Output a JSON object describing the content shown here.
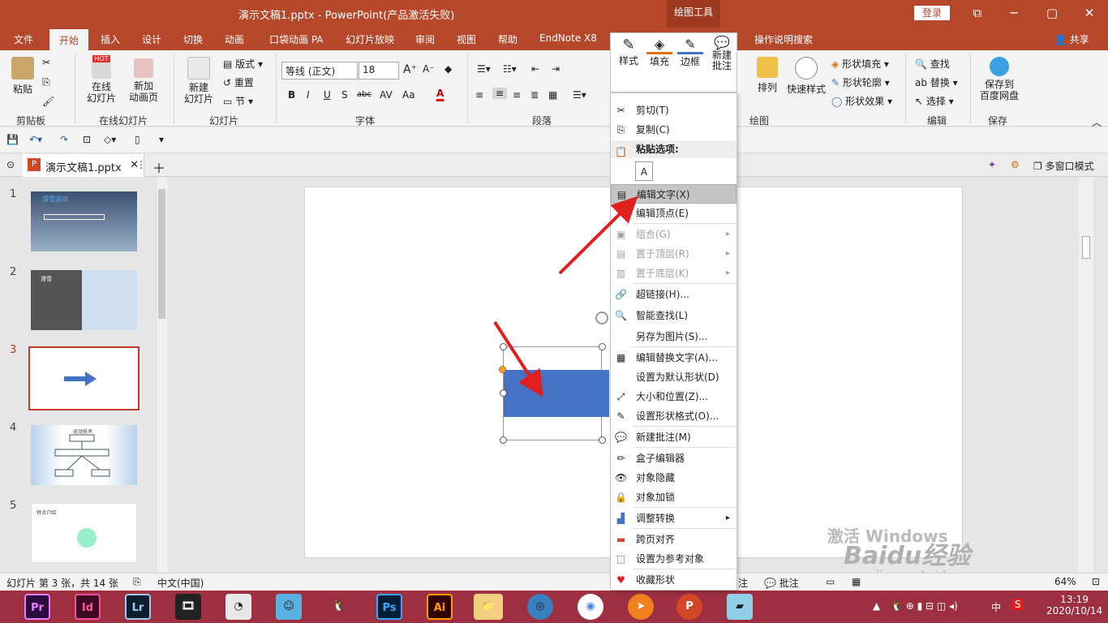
{
  "titlebar": {
    "title": "演示文稿1.pptx  -  PowerPoint(产品激活失败)",
    "context_tab": "绘图工具",
    "login": "登录",
    "restore_icon": "⧉",
    "min": "─",
    "max": "▢",
    "close": "✕"
  },
  "tabs": [
    "文件",
    "开始",
    "插入",
    "设计",
    "切换",
    "动画",
    "口袋动画 PA",
    "幻灯片放映",
    "审阅",
    "视图",
    "帮助",
    "EndNote X8"
  ],
  "tell_me": "操作说明搜索",
  "share": "共享",
  "ribbon": {
    "paste": "粘贴",
    "clipboard": "剪贴板",
    "online_slide": "在线\n幻灯片",
    "new_anim": "新加\n动画页",
    "online_group": "在线幻灯片",
    "hot": "HOT",
    "new_slide": "新建\n幻灯片",
    "layout": "版式",
    "reset": "重置",
    "section": "节",
    "slides_group": "幻灯片",
    "font_name": "等线 (正文)",
    "font_size": "18",
    "font_group": "字体",
    "bold": "B",
    "italic": "I",
    "underline": "U",
    "shadow": "S",
    "strike": "abc",
    "spacing": "AV",
    "case": "Aa",
    "color": "A",
    "para_group": "段落",
    "arrange": "排列",
    "quick_style": "快速样式",
    "drawing_group": "绘图",
    "shape_fill": "形状填充",
    "shape_outline": "形状轮廓",
    "shape_effect": "形状效果",
    "find": "查找",
    "replace": "替换",
    "select": "选择",
    "edit_group": "编辑",
    "save_baidu": "保存到\n百度网盘",
    "save_group": "保存"
  },
  "doc_tab": {
    "name": "演示文稿1.pptx",
    "multi_window": "多窗口模式"
  },
  "thumbs": [
    "1",
    "2",
    "3",
    "4",
    "5"
  ],
  "thumb_texts": {
    "t1": "滑雪运动",
    "t2": "滑雪",
    "t4": "运动技术",
    "t5": "特点介绍"
  },
  "status": {
    "slide": "幻灯片 第 3 张，共 14 张",
    "lang": "中文(中国)",
    "notes": "注",
    "comments": "批注",
    "zoom": "64%"
  },
  "mini_toolbar": [
    "样式",
    "填充",
    "边框",
    "新建\n批注"
  ],
  "menu": {
    "items": [
      {
        "label": "剪切(T)",
        "icon": "✂",
        "state": "normal"
      },
      {
        "label": "复制(C)",
        "icon": "⎘",
        "state": "normal"
      },
      {
        "label": "粘贴选项:",
        "icon": "📋",
        "state": "header"
      },
      {
        "label": "编辑文字(X)",
        "icon": "▤",
        "state": "highlight"
      },
      {
        "label": "编辑顶点(E)",
        "icon": "",
        "state": "normal"
      },
      {
        "label": "组合(G)",
        "icon": "▣",
        "state": "disabled",
        "sub": true
      },
      {
        "label": "置于顶层(R)",
        "icon": "▤",
        "state": "disabled",
        "sub": true
      },
      {
        "label": "置于底层(K)",
        "icon": "▥",
        "state": "disabled",
        "sub": true
      },
      {
        "label": "超链接(H)...",
        "icon": "🔗",
        "state": "normal"
      },
      {
        "label": "智能查找(L)",
        "icon": "🔍",
        "state": "normal"
      },
      {
        "label": "另存为图片(S)...",
        "icon": "",
        "state": "normal"
      },
      {
        "label": "编辑替换文字(A)...",
        "icon": "▦",
        "state": "normal"
      },
      {
        "label": "设置为默认形状(D)",
        "icon": "",
        "state": "normal"
      },
      {
        "label": "大小和位置(Z)...",
        "icon": "⤢",
        "state": "normal"
      },
      {
        "label": "设置形状格式(O)...",
        "icon": "✎",
        "state": "normal"
      },
      {
        "label": "新建批注(M)",
        "icon": "💬",
        "state": "normal"
      },
      {
        "label": "盒子编辑器",
        "icon": "✏",
        "state": "normal"
      },
      {
        "label": "对象隐藏",
        "icon": "👁",
        "state": "normal"
      },
      {
        "label": "对象加锁",
        "icon": "🔒",
        "state": "normal"
      },
      {
        "label": "调整转换",
        "icon": "▟",
        "state": "normal",
        "sub": true
      },
      {
        "label": "跨页对齐",
        "icon": "▬",
        "state": "normal"
      },
      {
        "label": "设置为参考对象",
        "icon": "⬚",
        "state": "normal"
      },
      {
        "label": "收藏形状",
        "icon": "♥",
        "state": "normal"
      }
    ]
  },
  "taskbar": {
    "apps": [
      "Pr",
      "Id",
      "Lr",
      "",
      "",
      "",
      "",
      "Ps",
      "Ai",
      "",
      "",
      "",
      "",
      "P",
      ""
    ],
    "time": "13:19",
    "date": "2020/10/14",
    "ime": "中"
  },
  "watermark": {
    "text1": "Baidu经验",
    "text2": "jingyan.baidu.com",
    "activate": "激活 Windows"
  },
  "colors": {
    "accent": "#b7472a",
    "shape": "#4472c4",
    "arrow": "#e02020"
  }
}
